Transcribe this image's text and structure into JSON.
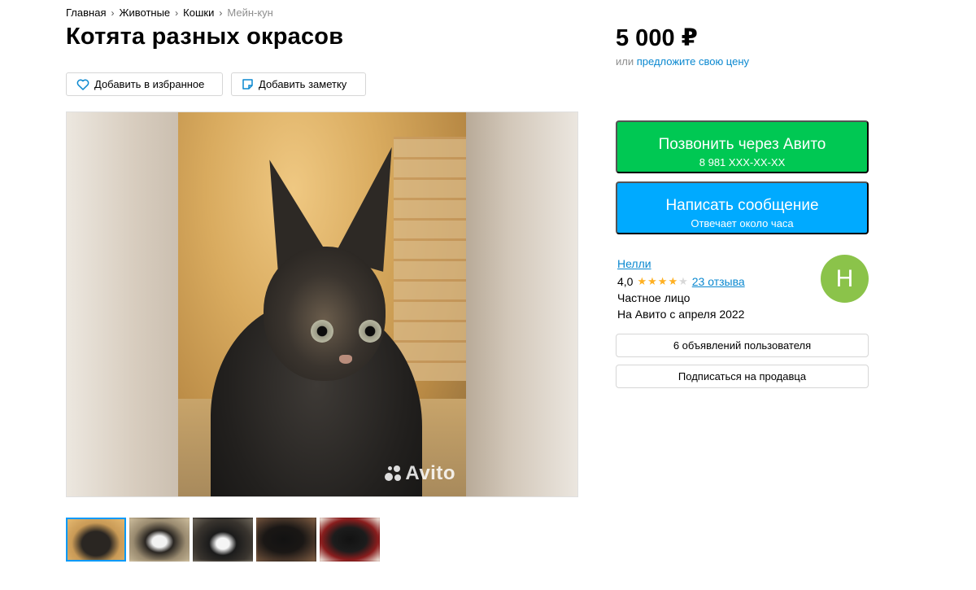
{
  "breadcrumbs": [
    {
      "label": "Главная"
    },
    {
      "label": "Животные"
    },
    {
      "label": "Кошки"
    },
    {
      "label": "Мейн-кун"
    }
  ],
  "title": "Котята разных окрасов",
  "price": "5 000 ₽",
  "offer": {
    "prefix": "или ",
    "link": "предложите свою цену"
  },
  "actions": {
    "favorite_label": "Добавить в избранное",
    "note_label": "Добавить заметку"
  },
  "gallery": {
    "watermark": "Avito",
    "thumbnail_count": 5,
    "active_index": 0
  },
  "contact": {
    "call_label": "Позвонить через Авито",
    "phone": "8 981 XXX-XX-XX",
    "message_label": "Написать сообщение",
    "response_time": "Отвечает около часа"
  },
  "seller": {
    "name": "Нелли",
    "rating": "4,0",
    "rating_value": 4,
    "rating_max": 5,
    "reviews": "23 отзыва",
    "type": "Частное лицо",
    "since": "На Авито с апреля 2022",
    "avatar_letter": "Н",
    "avatar_color": "#8bc34a"
  },
  "seller_buttons": {
    "ads_label": "6 объявлений пользователя",
    "subscribe_label": "Подписаться на продавца"
  },
  "colors": {
    "call": "#00c853",
    "message": "#00aaff",
    "link": "#0a88d0",
    "star": "#ffb021"
  }
}
